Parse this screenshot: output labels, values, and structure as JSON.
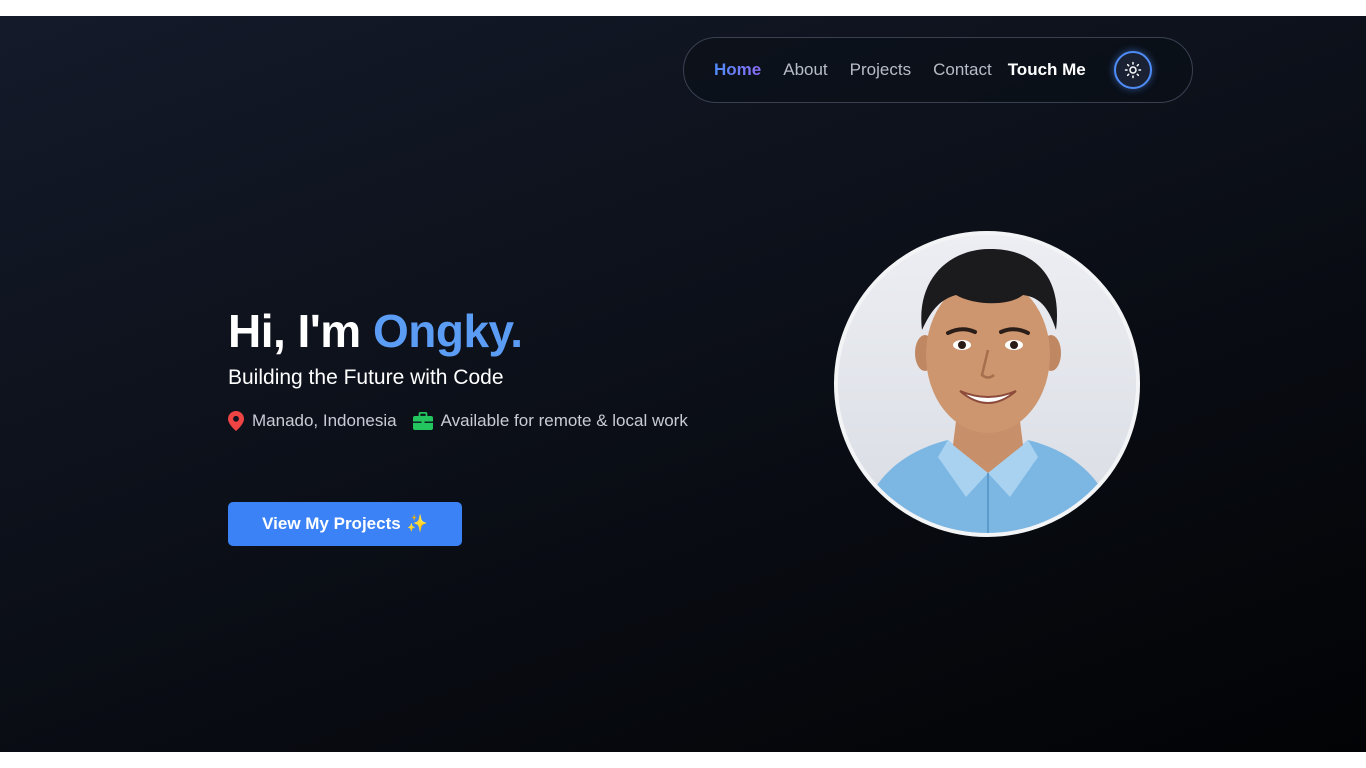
{
  "nav": {
    "items": [
      {
        "label": "Home"
      },
      {
        "label": "About"
      },
      {
        "label": "Projects"
      },
      {
        "label": "Contact"
      },
      {
        "label": "Touch Me"
      }
    ],
    "theme_toggle_icon": "sun-icon"
  },
  "hero": {
    "greeting": "Hi, I'm ",
    "name": "Ongky.",
    "subtitle": "Building the Future with Code",
    "location": "Manado, Indonesia",
    "location_icon": "map-pin-icon",
    "availability": "Available for remote & local work",
    "availability_icon": "briefcase-icon",
    "cta_label": "View My Projects",
    "cta_emoji": "✨",
    "avatar_icon": "profile-photo"
  },
  "colors": {
    "accent": "#3b82f6",
    "name_highlight": "#5b9cf5",
    "pin": "#ef4444",
    "briefcase": "#22c55e"
  }
}
